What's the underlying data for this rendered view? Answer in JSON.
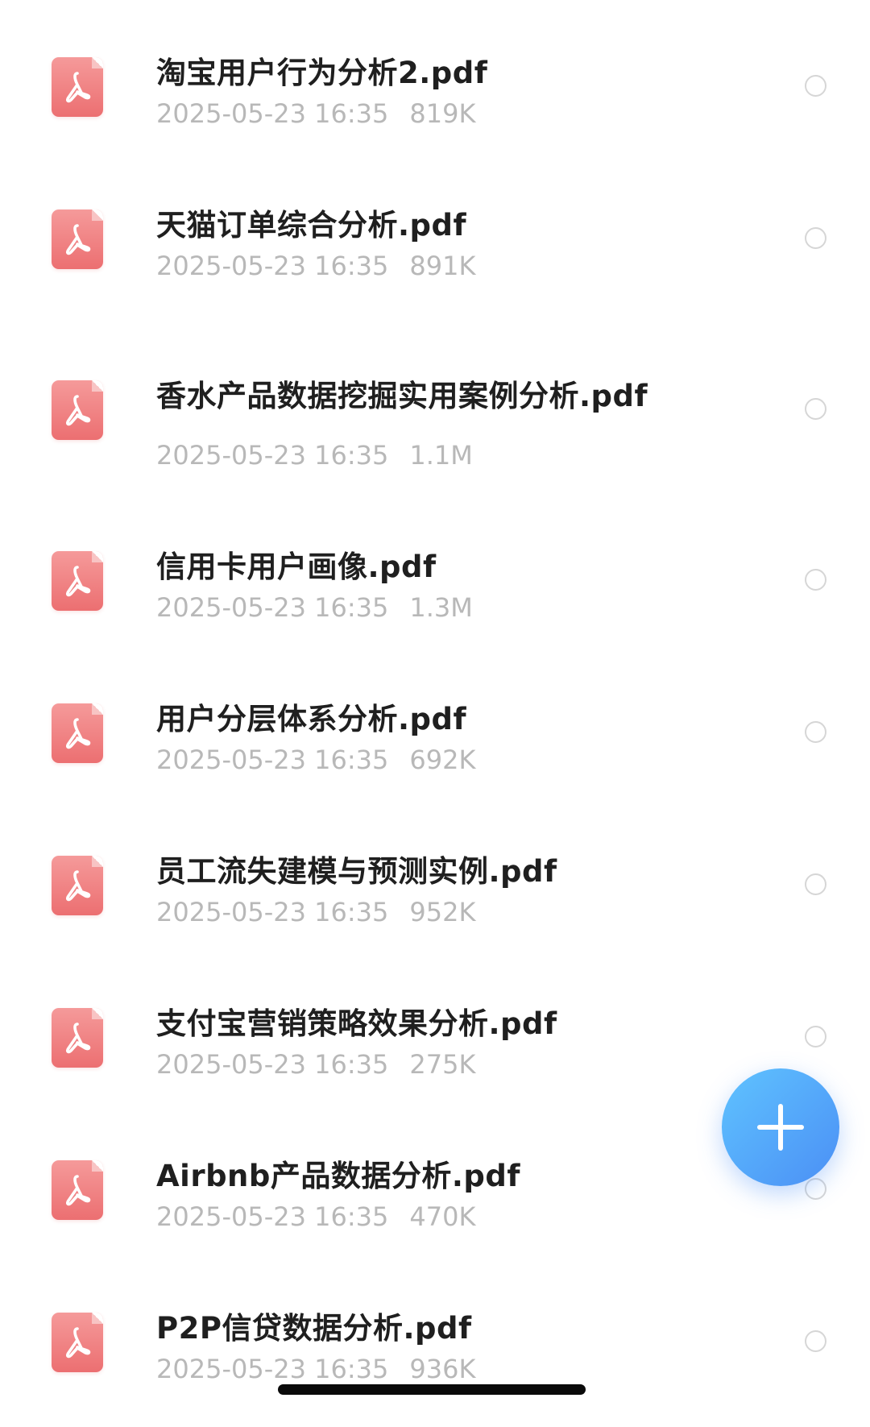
{
  "files": [
    {
      "name": "淘宝用户行为分析2.pdf",
      "date": "2025-05-23 16:35",
      "size": "819K",
      "icon": "pdf-icon"
    },
    {
      "name": "天猫订单综合分析.pdf",
      "date": "2025-05-23 16:35",
      "size": "891K",
      "icon": "pdf-icon"
    },
    {
      "name": "香水产品数据挖掘实用案例分析.pdf",
      "date": "2025-05-23 16:35",
      "size": "1.1M",
      "icon": "pdf-icon"
    },
    {
      "name": "信用卡用户画像.pdf",
      "date": "2025-05-23 16:35",
      "size": "1.3M",
      "icon": "pdf-icon"
    },
    {
      "name": "用户分层体系分析.pdf",
      "date": "2025-05-23 16:35",
      "size": "692K",
      "icon": "pdf-icon"
    },
    {
      "name": "员工流失建模与预测实例.pdf",
      "date": "2025-05-23 16:35",
      "size": "952K",
      "icon": "pdf-icon"
    },
    {
      "name": "支付宝营销策略效果分析.pdf",
      "date": "2025-05-23 16:35",
      "size": "275K",
      "icon": "pdf-icon"
    },
    {
      "name": "Airbnb产品数据分析.pdf",
      "date": "2025-05-23 16:35",
      "size": "470K",
      "icon": "pdf-icon"
    },
    {
      "name": "P2P信贷数据分析.pdf",
      "date": "2025-05-23 16:35",
      "size": "936K",
      "icon": "pdf-icon"
    }
  ],
  "fab": {
    "icon": "plus-icon"
  },
  "colors": {
    "pdf_icon": "#ec6f71",
    "fab": "#4b8ff5",
    "title_text": "#1f1f1f",
    "meta_text": "#b8b8b8"
  }
}
